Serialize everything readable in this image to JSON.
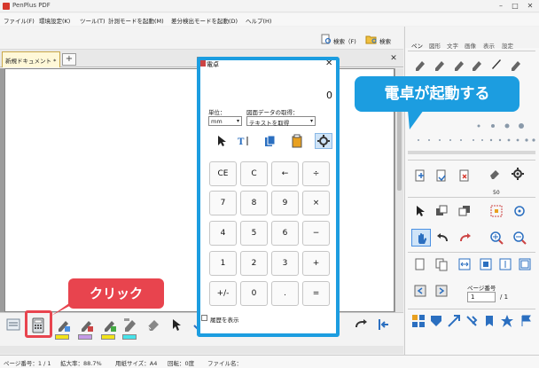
{
  "window": {
    "title": "PenPlus PDF"
  },
  "menu": [
    "ファイル(F)",
    "環境設定(K)",
    "ツール(T)",
    "計測モードを起動(M)",
    "差分検出モードを起動(D)",
    "ヘルプ(H)"
  ],
  "toolbar": {
    "search_label": "検索（F)",
    "folder_search_label": "検索"
  },
  "document_tab": {
    "label": "新規ドキュメント *"
  },
  "right_panel": {
    "tabs": [
      "ペン",
      "図形",
      "文字",
      "画像",
      "表示",
      "設定"
    ],
    "pen_size_label": "50",
    "page_number_label": "ページ番号",
    "page_current": "1",
    "page_total": "/ 1"
  },
  "calculator": {
    "title": "電卓",
    "display": "0",
    "unit_label": "単位：",
    "unit_value": "mm",
    "get_label": "図面データの取得：",
    "get_value": "テキストを取得",
    "keys": [
      "CE",
      "C",
      "←",
      "÷",
      "7",
      "8",
      "9",
      "×",
      "4",
      "5",
      "6",
      "−",
      "1",
      "2",
      "3",
      "+",
      "+/-",
      "0",
      ".",
      "="
    ],
    "history_label": "履歴を表示"
  },
  "callouts": {
    "launch_text": "電卓が起動する",
    "click_text": "クリック"
  },
  "status": {
    "page": "ページ番号：1 / 1",
    "zoom": "拡大率：88.7%",
    "paper": "用紙サイズ：A4",
    "rotation": "回転：0度",
    "filename": "ファイル名："
  },
  "colors": {
    "accent_blue": "#1c9de0",
    "accent_red": "#e8444e",
    "swatches": [
      "#f2e31a",
      "#c49ae6",
      "#f2e31a",
      "#46e3ea"
    ]
  }
}
